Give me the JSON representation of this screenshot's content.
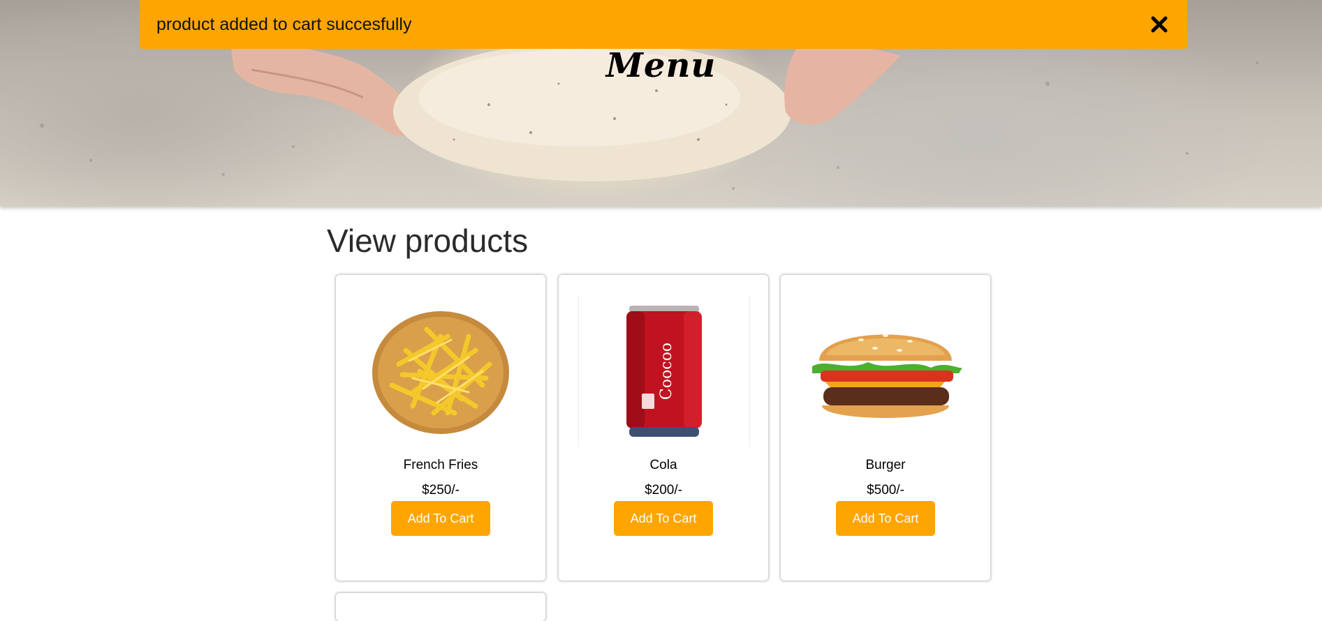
{
  "notification": {
    "message": "product added to cart succesfully",
    "close_icon": "close-icon",
    "background": "#ffa500"
  },
  "hero": {
    "title": "Menu",
    "image": "dough-kneading-photo"
  },
  "products_section": {
    "title": "View products",
    "items": [
      {
        "name": "French Fries",
        "price": "$250/-",
        "button_label": "Add To Cart",
        "image": "french-fries-image"
      },
      {
        "name": "Cola",
        "price": "$200/-",
        "button_label": "Add To Cart",
        "image": "cola-can-image",
        "can_text": "Coocoo"
      },
      {
        "name": "Burger",
        "price": "$500/-",
        "button_label": "Add To Cart",
        "image": "burger-image"
      }
    ]
  },
  "colors": {
    "accent": "#ffa500",
    "heading": "#2a2a2a"
  }
}
